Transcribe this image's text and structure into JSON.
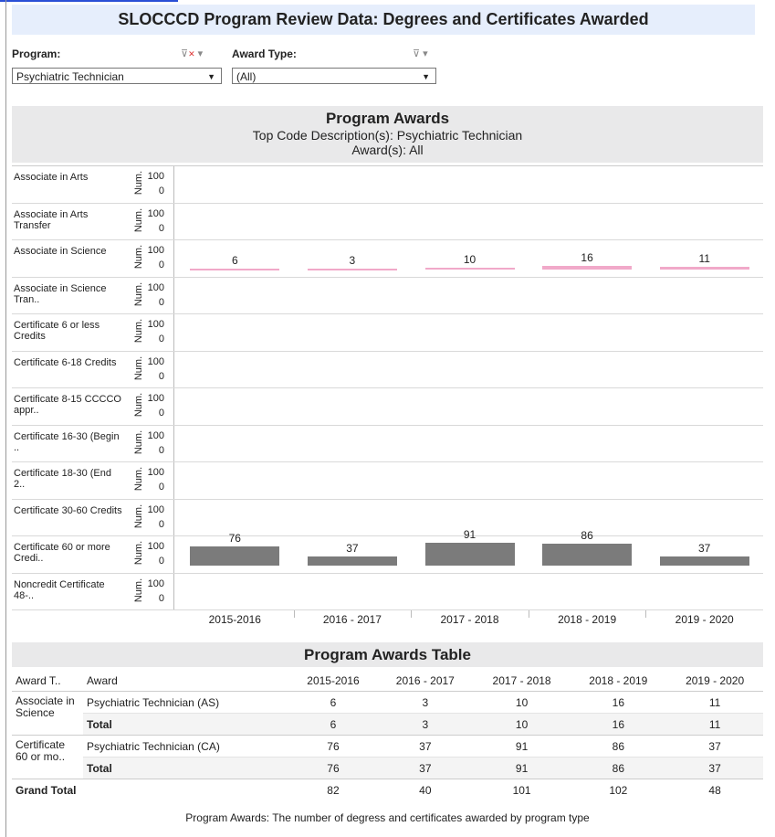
{
  "page": {
    "title": "SLOCCCD Program Review Data: Degrees and Certificates Awarded",
    "footer": "Program Awards: The number of degress and certificates awarded by program type"
  },
  "filters": {
    "program_label": "Program:",
    "program_value": "Psychiatric Technician",
    "award_type_label": "Award Type:",
    "award_type_value": "(All)"
  },
  "chart_header": {
    "title": "Program Awards",
    "line1": "Top Code Description(s): Psychiatric Technician",
    "line2": "Award(s): All"
  },
  "chart_data": {
    "type": "bar",
    "categories": [
      "2015-2016",
      "2016 - 2017",
      "2017 - 2018",
      "2018 - 2019",
      "2019 - 2020"
    ],
    "axis_title": "Num.",
    "ytick_top": "100",
    "ytick_bottom": "0",
    "ylim": [
      0,
      100
    ],
    "rows": [
      {
        "label": "Associate in Arts",
        "values": []
      },
      {
        "label": "Associate in Arts Transfer",
        "values": []
      },
      {
        "label": "Associate in Science",
        "values": [
          6,
          3,
          10,
          16,
          11
        ],
        "color": "#f1a9c9"
      },
      {
        "label": "Associate in Science Tran..",
        "values": []
      },
      {
        "label": "Certificate 6 or less Credits",
        "values": []
      },
      {
        "label": "Certificate 6-18 Credits",
        "values": []
      },
      {
        "label": "Certificate 8-15 CCCCO appr..",
        "values": []
      },
      {
        "label": "Certificate 16-30 (Begin ..",
        "values": []
      },
      {
        "label": "Certificate 18-30 (End 2..",
        "values": []
      },
      {
        "label": "Certificate 30-60 Credits",
        "values": []
      },
      {
        "label": "Certificate 60 or more Credi..",
        "values": [
          76,
          37,
          91,
          86,
          37
        ],
        "color": "#7b7b7b"
      },
      {
        "label": "Noncredit Certificate 48-..",
        "values": []
      }
    ]
  },
  "table": {
    "title": "Program Awards Table",
    "headers": [
      "Award T..",
      "Award",
      "2015-2016",
      "2016 - 2017",
      "2017 - 2018",
      "2018 - 2019",
      "2019 - 2020"
    ],
    "groups": [
      {
        "type": "Associate in Science",
        "award": "Psychiatric Technician (AS)",
        "values": [
          "6",
          "3",
          "10",
          "16",
          "11"
        ],
        "total_label": "Total",
        "totals": [
          "6",
          "3",
          "10",
          "16",
          "11"
        ]
      },
      {
        "type": "Certificate 60 or mo..",
        "award": "Psychiatric Technician (CA)",
        "values": [
          "76",
          "37",
          "91",
          "86",
          "37"
        ],
        "total_label": "Total",
        "totals": [
          "76",
          "37",
          "91",
          "86",
          "37"
        ]
      }
    ],
    "grand_total_label": "Grand Total",
    "grand_totals": [
      "82",
      "40",
      "101",
      "102",
      "48"
    ]
  },
  "icons": {
    "program_filter": "filter-clear-icon",
    "award_filter": "filter-icon",
    "dropdown": "caret-down-icon"
  }
}
